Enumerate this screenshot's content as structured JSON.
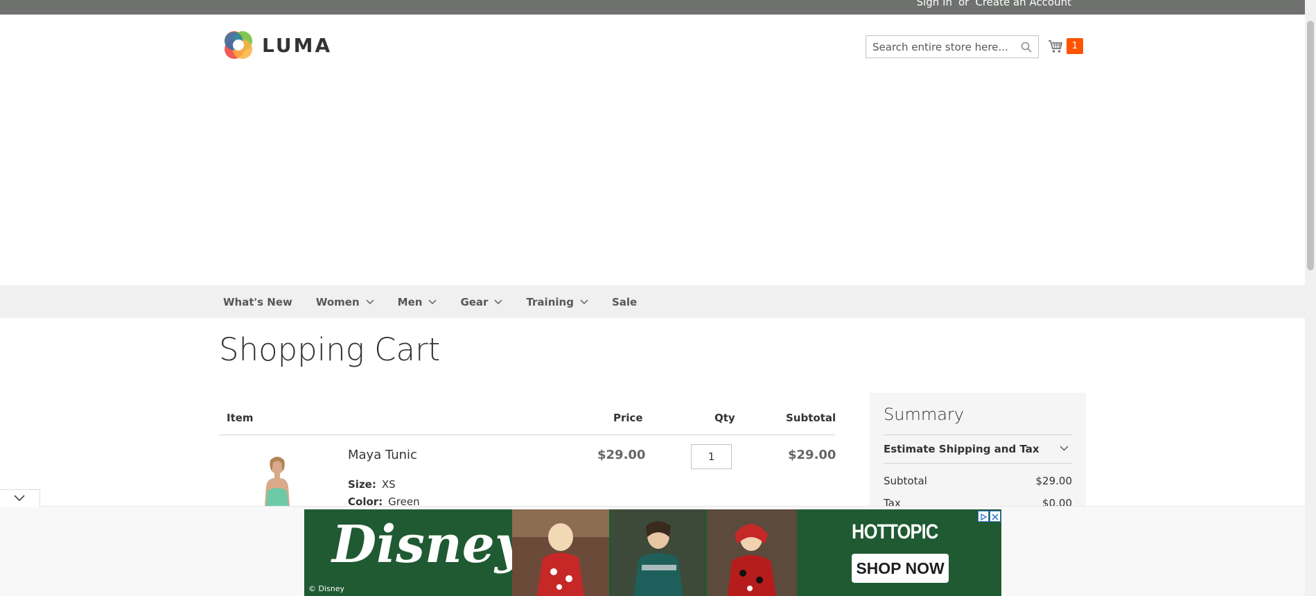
{
  "topbar": {
    "sign_in": "Sign In",
    "or": "or",
    "create_account": "Create an Account"
  },
  "header": {
    "logo_text": "LUMA",
    "search_placeholder": "Search entire store here...",
    "cart_count": "1"
  },
  "nav": {
    "items": [
      {
        "label": "What's New",
        "dropdown": false
      },
      {
        "label": "Women",
        "dropdown": true
      },
      {
        "label": "Men",
        "dropdown": true
      },
      {
        "label": "Gear",
        "dropdown": true
      },
      {
        "label": "Training",
        "dropdown": true
      },
      {
        "label": "Sale",
        "dropdown": false
      }
    ]
  },
  "page": {
    "title": "Shopping Cart"
  },
  "cart": {
    "headers": {
      "item": "Item",
      "price": "Price",
      "qty": "Qty",
      "subtotal": "Subtotal"
    },
    "items": [
      {
        "name": "Maya Tunic",
        "price": "$29.00",
        "qty": "1",
        "subtotal": "$29.00",
        "options": [
          {
            "label": "Size:",
            "value": "XS"
          },
          {
            "label": "Color:",
            "value": "Green"
          }
        ]
      }
    ]
  },
  "summary": {
    "title": "Summary",
    "estimate_label": "Estimate Shipping and Tax",
    "subtotal_label": "Subtotal",
    "subtotal_value": "$29.00",
    "tax_label": "Tax",
    "tax_value": "$0.00"
  },
  "ad": {
    "brand_left": "Disney",
    "copyright": "© Disney",
    "brand_right": "HOTTOPIC",
    "cta": "SHOP NOW"
  },
  "colors": {
    "topbar": "#6e716e",
    "cart_badge": "#ff5501",
    "nav_bg": "#f0f0f0",
    "ad_green": "#1f5a32"
  }
}
